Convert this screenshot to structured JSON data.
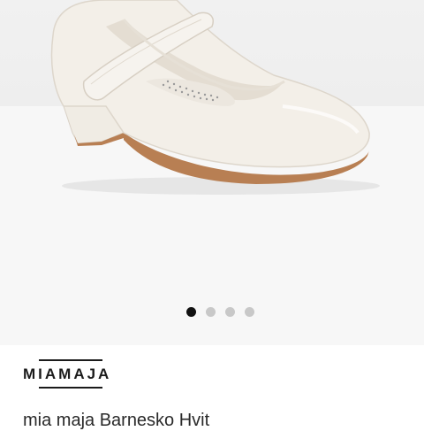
{
  "product": {
    "brand": "MIAMAJA",
    "title": "mia maja Barnesko Hvit"
  },
  "gallery": {
    "image_count": 4,
    "active_index": 0,
    "dot_active_color": "#111111",
    "dot_inactive_color": "#c8c8c8"
  }
}
